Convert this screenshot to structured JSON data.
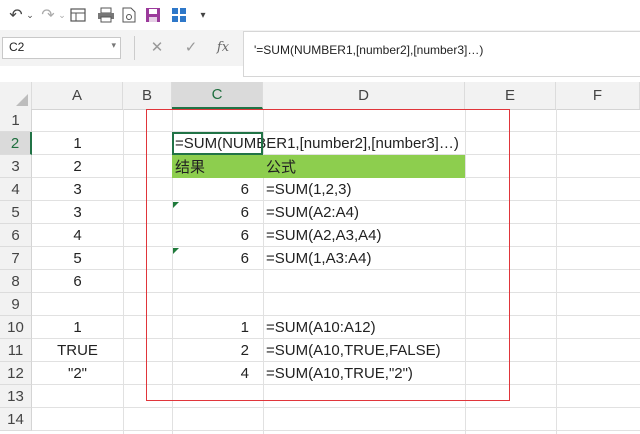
{
  "toolbar": {
    "icons": [
      "undo-icon",
      "chevron-down-icon",
      "redo-icon",
      "chevron-down-icon",
      "sep",
      "print-preview-icon",
      "print-icon",
      "save-icon",
      "form-icon",
      "customize-qat-icon"
    ]
  },
  "formula_bar": {
    "name_box": "C2",
    "fx_label": "fx",
    "content": "'=SUM(NUMBER1,[number2],[number3]…)"
  },
  "columns": [
    "A",
    "B",
    "C",
    "D",
    "E",
    "F"
  ],
  "selected_column": "C",
  "rows": [
    "1",
    "2",
    "3",
    "4",
    "5",
    "6",
    "7",
    "8",
    "9",
    "10",
    "11",
    "12",
    "13",
    "14"
  ],
  "selected_row": "2",
  "cells": {
    "A2": "1",
    "A3": "2",
    "A4": "3",
    "A5": "3",
    "A6": "4",
    "A7": "5",
    "A8": "6",
    "A10": "1",
    "A11": "TRUE",
    "A12": "\"2\"",
    "C2": "=SUM(NUMBER1,[number2],[number3]…)",
    "C3": "结果",
    "D3": "公式",
    "C4": "6",
    "D4": "=SUM(1,2,3)",
    "C5": "6",
    "D5": "=SUM(A2:A4)",
    "C6": "6",
    "D6": "=SUM(A2,A3,A4)",
    "C7": "6",
    "D7": "=SUM(1,A3:A4)",
    "C10": "1",
    "D10": "=SUM(A10:A12)",
    "C11": "2",
    "D11": "=SUM(A10,TRUE,FALSE)",
    "C12": "4",
    "D12": "=SUM(A10,TRUE,\"2\")"
  },
  "colors": {
    "header_fill": "#8dce4e",
    "annotation_box": "#e0353a",
    "selection": "#217346"
  }
}
